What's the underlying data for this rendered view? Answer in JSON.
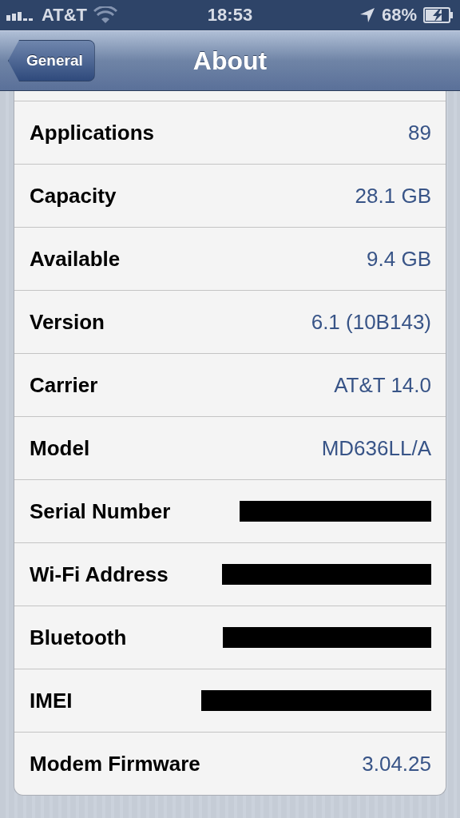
{
  "status_bar": {
    "carrier": "AT&T",
    "time": "18:53",
    "battery": "68%"
  },
  "nav_bar": {
    "back_button": "General",
    "title": "About"
  },
  "rows": [
    {
      "kind": "text",
      "label": "Applications",
      "value": "89"
    },
    {
      "kind": "text",
      "label": "Capacity",
      "value": "28.1 GB"
    },
    {
      "kind": "text",
      "label": "Available",
      "value": "9.4 GB"
    },
    {
      "kind": "text",
      "label": "Version",
      "value": "6.1 (10B143)"
    },
    {
      "kind": "text",
      "label": "Carrier",
      "value": "AT&T 14.0"
    },
    {
      "kind": "text",
      "label": "Model",
      "value": "MD636LL/A"
    },
    {
      "kind": "redacted",
      "label": "Serial Number"
    },
    {
      "kind": "redacted",
      "label": "Wi-Fi Address"
    },
    {
      "kind": "redacted",
      "label": "Bluetooth"
    },
    {
      "kind": "redacted",
      "label": "IMEI"
    },
    {
      "kind": "text",
      "label": "Modem Firmware",
      "value": "3.04.25"
    }
  ]
}
